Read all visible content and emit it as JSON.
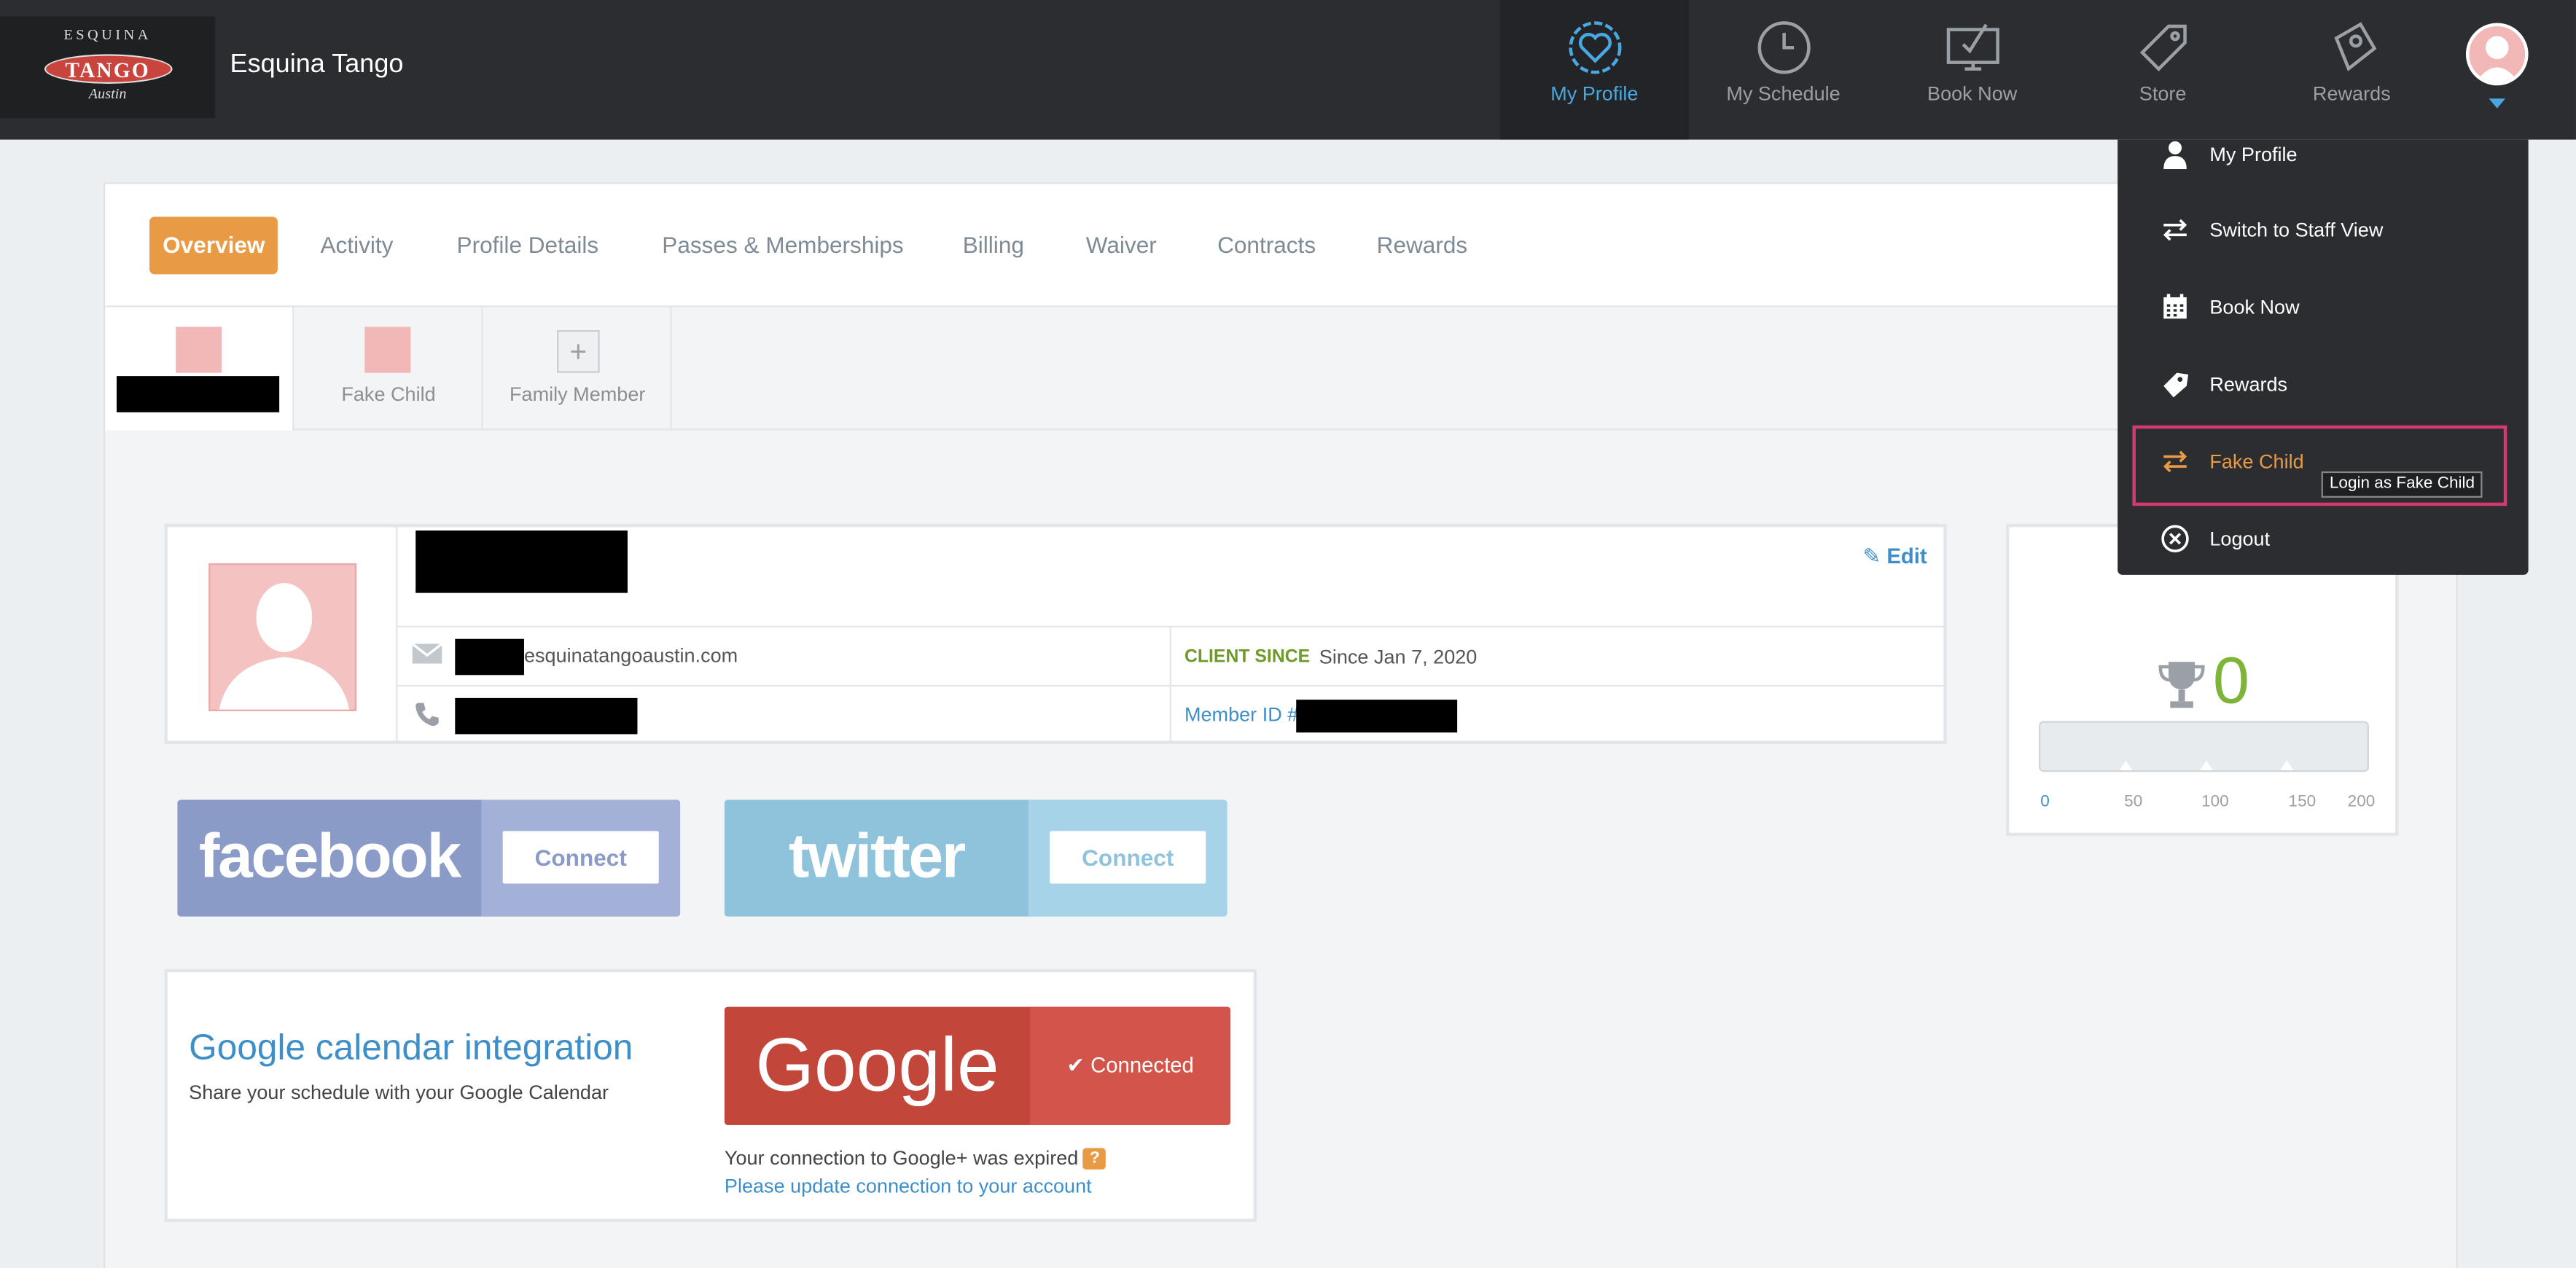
{
  "header": {
    "logo": {
      "top": "ESQUINA",
      "middle": "TANGO",
      "bottom": "Austin"
    },
    "brand": "Esquina Tango",
    "nav": [
      {
        "label": "My Profile",
        "icon": "heart-badge-icon",
        "active": true
      },
      {
        "label": "My Schedule",
        "icon": "clock-icon",
        "active": false
      },
      {
        "label": "Book Now",
        "icon": "monitor-check-icon",
        "active": false
      },
      {
        "label": "Store",
        "icon": "tag-icon",
        "active": false
      },
      {
        "label": "Rewards",
        "icon": "reward-tag-icon",
        "active": false
      }
    ]
  },
  "tabs": [
    "Overview",
    "Activity",
    "Profile Details",
    "Passes & Memberships",
    "Billing",
    "Waiver",
    "Contracts",
    "Rewards"
  ],
  "members": {
    "child": "Fake Child",
    "add": "Family Member",
    "add_symbol": "+"
  },
  "profile": {
    "edit_label": "Edit",
    "email_suffix": "esquinatangoaustin.com",
    "client_since_label": "CLIENT SINCE",
    "client_since_value": "Since Jan 7, 2020",
    "member_id_label": "Member ID #"
  },
  "rewards": {
    "points": "0",
    "ticks": [
      "0",
      "50",
      "100",
      "150",
      "200"
    ],
    "progress": 0
  },
  "social": {
    "facebook": {
      "brand": "facebook",
      "button": "Connect",
      "color": "#8b9bc7"
    },
    "twitter": {
      "brand": "twitter",
      "button": "Connect",
      "color": "#8fc3dc"
    }
  },
  "google": {
    "title": "Google calendar integration",
    "subtitle": "Share your schedule with your Google Calendar",
    "brand": "Google",
    "status": "✔ Connected",
    "expired": "Your connection to Google+ was expired",
    "help": "?",
    "update": "Please update connection to your account"
  },
  "dropdown": {
    "items": [
      {
        "label": "My Profile",
        "icon": "person-icon"
      },
      {
        "label": "Switch to Staff View",
        "icon": "switch-arrows-icon"
      },
      {
        "label": "Book Now",
        "icon": "calendar-icon"
      },
      {
        "label": "Rewards",
        "icon": "ticket-icon"
      },
      {
        "label": "Fake Child",
        "icon": "switch-arrows-icon",
        "highlighted": true
      },
      {
        "label": "Logout",
        "icon": "close-circle-icon"
      }
    ],
    "tooltip": "Login as Fake Child"
  }
}
